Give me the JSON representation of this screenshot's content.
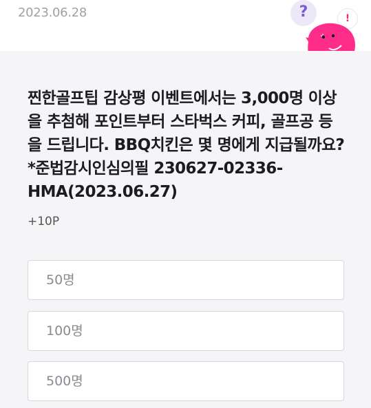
{
  "header": {
    "date": "2023.06.28",
    "question_icon": "question-mark-icon",
    "question_mark": "?",
    "alert_icon": "exclamation-icon",
    "alert_mark": "!",
    "mascot": "pink-blob-mascot"
  },
  "quiz": {
    "question": "찐한골프팁 감상평 이벤트에서는 3,000명 이상\n을 추첨해 포인트부터 스타벅스 커피, 골프공 등\n을 드립니다. BBQ치킨은 몇 명에게 지급될까요?\n*준법감시인심의필 230627-02336-\nHMA(2023.06.27)",
    "points": "+10P",
    "options": [
      {
        "label": "50명"
      },
      {
        "label": "100명"
      },
      {
        "label": "500명"
      }
    ]
  },
  "colors": {
    "accent_purple": "#7a5bd6",
    "mascot_pink": "#ff2d8a",
    "background": "#f5f5f7"
  }
}
